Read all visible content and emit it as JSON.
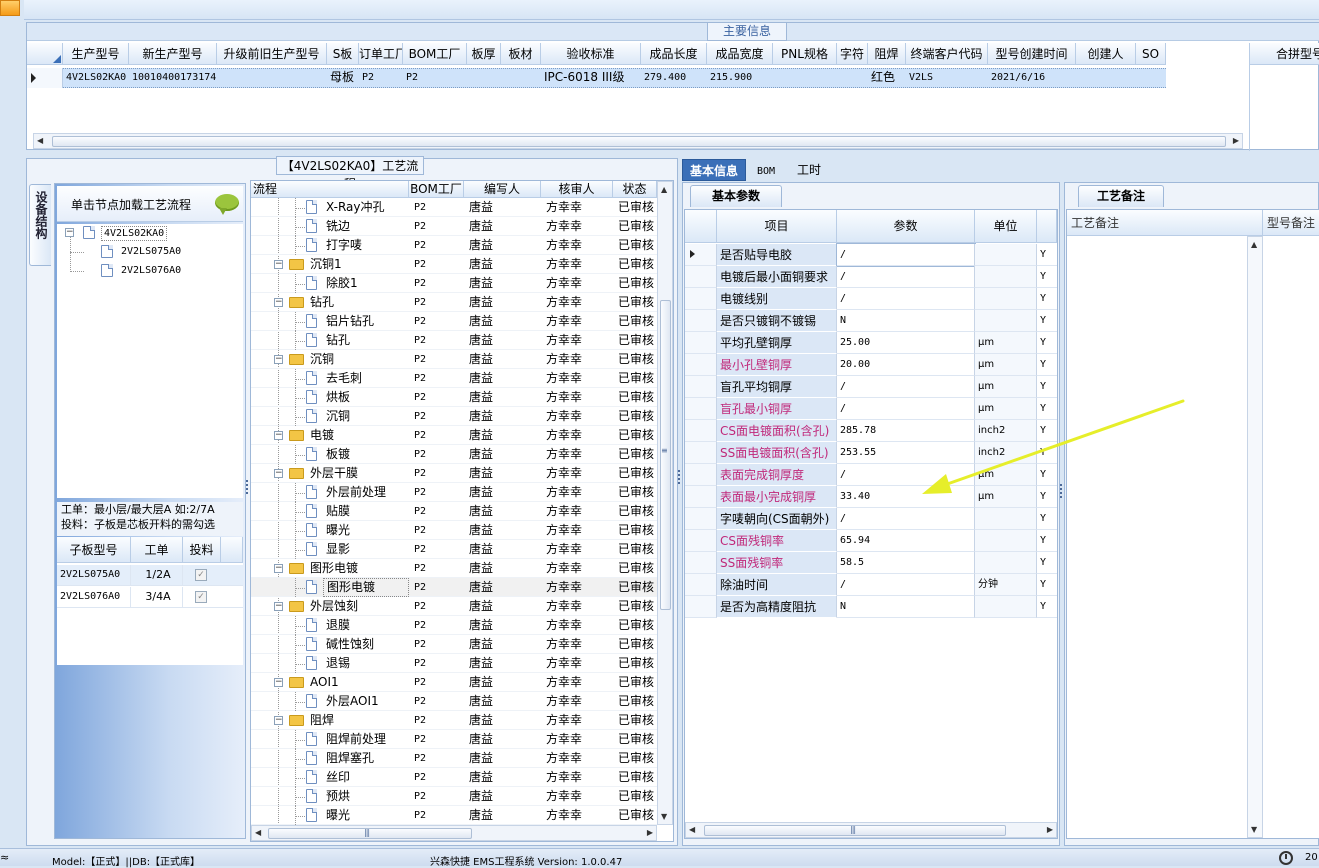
{
  "top_panel": {
    "caption": "主要信息",
    "columns": [
      "生产型号",
      "新生产型号",
      "升级前旧生产型号",
      "S板",
      "订单工厂",
      "BOM工厂",
      "板厚",
      "板材",
      "验收标准",
      "成品长度",
      "成品宽度",
      "PNL规格",
      "字符",
      "阻焊",
      "终端客户代码",
      "型号创建时间",
      "创建人",
      "SO"
    ],
    "row": {
      "生产型号": "4V2LS02KA0",
      "新生产型号": "10010400173174",
      "升级前旧生产型号": "",
      "S板": "母板",
      "订单工厂": "P2",
      "BOM工厂": "P2",
      "板厚": "",
      "板材": "",
      "验收标准": "IPC-6018 III级",
      "成品长度": "279.400",
      "成品宽度": "215.900",
      "PNL规格": "",
      "字符": "",
      "阻焊": "红色",
      "终端客户代码": "V2LS",
      "型号创建时间": "2021/6/16",
      "创建人": "",
      "SO": ""
    },
    "right_header": "合拼型号"
  },
  "process_panel": {
    "caption": "【4V2LS02KA0】工艺流程",
    "side_tab": "设备结构",
    "load_hint": "单击节点加载工艺流程",
    "tree": {
      "root": "4V2LS02KA0",
      "children": [
        "2V2LS075A0",
        "2V2LS076A0"
      ]
    },
    "note_line1": "工单：最小层/最大层A 如:2/7A",
    "note_line2": "投料：子板是芯板开料的需勾选",
    "sub_columns": [
      "子板型号",
      "工单",
      "投料"
    ],
    "sub_rows": [
      {
        "model": "2V2LS075A0",
        "order": "1/2A",
        "fed": true
      },
      {
        "model": "2V2LS076A0",
        "order": "3/4A",
        "fed": true
      }
    ],
    "flow_columns": [
      "流程",
      "BOM工厂",
      "编写人",
      "核审人",
      "状态"
    ],
    "flow_rows": [
      {
        "level": 1,
        "name": "X-Ray冲孔",
        "bom": "P2",
        "writer": "唐益",
        "reviewer": "方幸幸",
        "status": "已审核"
      },
      {
        "level": 1,
        "name": "铣边",
        "bom": "P2",
        "writer": "唐益",
        "reviewer": "方幸幸",
        "status": "已审核"
      },
      {
        "level": 1,
        "name": "打字唛",
        "bom": "P2",
        "writer": "唐益",
        "reviewer": "方幸幸",
        "status": "已审核"
      },
      {
        "level": 0,
        "name": "沉铜1",
        "bom": "P2",
        "writer": "唐益",
        "reviewer": "方幸幸",
        "status": "已审核"
      },
      {
        "level": 1,
        "name": "除胶1",
        "bom": "P2",
        "writer": "唐益",
        "reviewer": "方幸幸",
        "status": "已审核"
      },
      {
        "level": 0,
        "name": "钻孔",
        "bom": "P2",
        "writer": "唐益",
        "reviewer": "方幸幸",
        "status": "已审核"
      },
      {
        "level": 1,
        "name": "铝片钻孔",
        "bom": "P2",
        "writer": "唐益",
        "reviewer": "方幸幸",
        "status": "已审核"
      },
      {
        "level": 1,
        "name": "钻孔",
        "bom": "P2",
        "writer": "唐益",
        "reviewer": "方幸幸",
        "status": "已审核"
      },
      {
        "level": 0,
        "name": "沉铜",
        "bom": "P2",
        "writer": "唐益",
        "reviewer": "方幸幸",
        "status": "已审核"
      },
      {
        "level": 1,
        "name": "去毛刺",
        "bom": "P2",
        "writer": "唐益",
        "reviewer": "方幸幸",
        "status": "已审核"
      },
      {
        "level": 1,
        "name": "烘板",
        "bom": "P2",
        "writer": "唐益",
        "reviewer": "方幸幸",
        "status": "已审核"
      },
      {
        "level": 1,
        "name": "沉铜",
        "bom": "P2",
        "writer": "唐益",
        "reviewer": "方幸幸",
        "status": "已审核"
      },
      {
        "level": 0,
        "name": "电镀",
        "bom": "P2",
        "writer": "唐益",
        "reviewer": "方幸幸",
        "status": "已审核"
      },
      {
        "level": 1,
        "name": "板镀",
        "bom": "P2",
        "writer": "唐益",
        "reviewer": "方幸幸",
        "status": "已审核"
      },
      {
        "level": 0,
        "name": "外层干膜",
        "bom": "P2",
        "writer": "唐益",
        "reviewer": "方幸幸",
        "status": "已审核"
      },
      {
        "level": 1,
        "name": "外层前处理",
        "bom": "P2",
        "writer": "唐益",
        "reviewer": "方幸幸",
        "status": "已审核"
      },
      {
        "level": 1,
        "name": "贴膜",
        "bom": "P2",
        "writer": "唐益",
        "reviewer": "方幸幸",
        "status": "已审核"
      },
      {
        "level": 1,
        "name": "曝光",
        "bom": "P2",
        "writer": "唐益",
        "reviewer": "方幸幸",
        "status": "已审核"
      },
      {
        "level": 1,
        "name": "显影",
        "bom": "P2",
        "writer": "唐益",
        "reviewer": "方幸幸",
        "status": "已审核"
      },
      {
        "level": 0,
        "name": "图形电镀",
        "bom": "P2",
        "writer": "唐益",
        "reviewer": "方幸幸",
        "status": "已审核"
      },
      {
        "level": 1,
        "name": "图形电镀",
        "bom": "P2",
        "writer": "唐益",
        "reviewer": "方幸幸",
        "status": "已审核",
        "selected": true
      },
      {
        "level": 0,
        "name": "外层蚀刻",
        "bom": "P2",
        "writer": "唐益",
        "reviewer": "方幸幸",
        "status": "已审核"
      },
      {
        "level": 1,
        "name": "退膜",
        "bom": "P2",
        "writer": "唐益",
        "reviewer": "方幸幸",
        "status": "已审核"
      },
      {
        "level": 1,
        "name": "碱性蚀刻",
        "bom": "P2",
        "writer": "唐益",
        "reviewer": "方幸幸",
        "status": "已审核"
      },
      {
        "level": 1,
        "name": "退锡",
        "bom": "P2",
        "writer": "唐益",
        "reviewer": "方幸幸",
        "status": "已审核"
      },
      {
        "level": 0,
        "name": "AOI1",
        "bom": "P2",
        "writer": "唐益",
        "reviewer": "方幸幸",
        "status": "已审核"
      },
      {
        "level": 1,
        "name": "外层AOI1",
        "bom": "P2",
        "writer": "唐益",
        "reviewer": "方幸幸",
        "status": "已审核"
      },
      {
        "level": 0,
        "name": "阻焊",
        "bom": "P2",
        "writer": "唐益",
        "reviewer": "方幸幸",
        "status": "已审核"
      },
      {
        "level": 1,
        "name": "阻焊前处理",
        "bom": "P2",
        "writer": "唐益",
        "reviewer": "方幸幸",
        "status": "已审核"
      },
      {
        "level": 1,
        "name": "阻焊塞孔",
        "bom": "P2",
        "writer": "唐益",
        "reviewer": "方幸幸",
        "status": "已审核"
      },
      {
        "level": 1,
        "name": "丝印",
        "bom": "P2",
        "writer": "唐益",
        "reviewer": "方幸幸",
        "status": "已审核"
      },
      {
        "level": 1,
        "name": "预烘",
        "bom": "P2",
        "writer": "唐益",
        "reviewer": "方幸幸",
        "status": "已审核"
      },
      {
        "level": 1,
        "name": "曝光",
        "bom": "P2",
        "writer": "唐益",
        "reviewer": "方幸幸",
        "status": "已审核"
      }
    ]
  },
  "info_panel": {
    "tabs": [
      "基本信息",
      "BOM",
      "工时"
    ],
    "subtab": "基本参数",
    "columns": [
      "项目",
      "参数",
      "单位"
    ],
    "rows": [
      {
        "item": "是否贴导电胶",
        "value": "/",
        "unit": "",
        "flag": "Y",
        "pink": false
      },
      {
        "item": "电镀后最小面铜要求",
        "value": "/",
        "unit": "",
        "flag": "Y",
        "pink": false
      },
      {
        "item": "电镀线别",
        "value": "/",
        "unit": "",
        "flag": "Y",
        "pink": false
      },
      {
        "item": "是否只镀铜不镀锡",
        "value": "N",
        "unit": "",
        "flag": "Y",
        "pink": false
      },
      {
        "item": "平均孔壁铜厚",
        "value": "25.00",
        "unit": "μm",
        "flag": "Y",
        "pink": false
      },
      {
        "item": "最小孔壁铜厚",
        "value": "20.00",
        "unit": "μm",
        "flag": "Y",
        "pink": true
      },
      {
        "item": "盲孔平均铜厚",
        "value": "/",
        "unit": "μm",
        "flag": "Y",
        "pink": false
      },
      {
        "item": "盲孔最小铜厚",
        "value": "/",
        "unit": "μm",
        "flag": "Y",
        "pink": true
      },
      {
        "item": "CS面电镀面积(含孔)",
        "value": "285.78",
        "unit": "inch2",
        "flag": "Y",
        "pink": true
      },
      {
        "item": "SS面电镀面积(含孔)",
        "value": "253.55",
        "unit": "inch2",
        "flag": "Y",
        "pink": true
      },
      {
        "item": "表面完成铜厚度",
        "value": "/",
        "unit": "μm",
        "flag": "Y",
        "pink": true
      },
      {
        "item": "表面最小完成铜厚",
        "value": "33.40",
        "unit": "μm",
        "flag": "Y",
        "pink": true
      },
      {
        "item": "字唛朝向(CS面朝外)",
        "value": "/",
        "unit": "",
        "flag": "Y",
        "pink": false
      },
      {
        "item": "CS面残铜率",
        "value": "65.94",
        "unit": "",
        "flag": "Y",
        "pink": true
      },
      {
        "item": "SS面残铜率",
        "value": "58.5",
        "unit": "",
        "flag": "Y",
        "pink": true
      },
      {
        "item": "除油时间",
        "value": "/",
        "unit": "分钟",
        "flag": "Y",
        "pink": false
      },
      {
        "item": "是否为高精度阻抗",
        "value": "N",
        "unit": "",
        "flag": "Y",
        "pink": false
      }
    ]
  },
  "remark_panel": {
    "tab": "工艺备注",
    "columns": [
      "工艺备注",
      "型号备注"
    ]
  },
  "status_bar": {
    "model_text": "Model:【正式】||DB:【正式库】",
    "system_text": "兴森快捷 EMS工程系统 Version: 1.0.0.47",
    "clock_text": "20"
  },
  "colors": {
    "pink": "#c0287a",
    "accent": "#3a6fb8",
    "selected": "#cfe3fa",
    "arrow": "#e6ee2a"
  }
}
